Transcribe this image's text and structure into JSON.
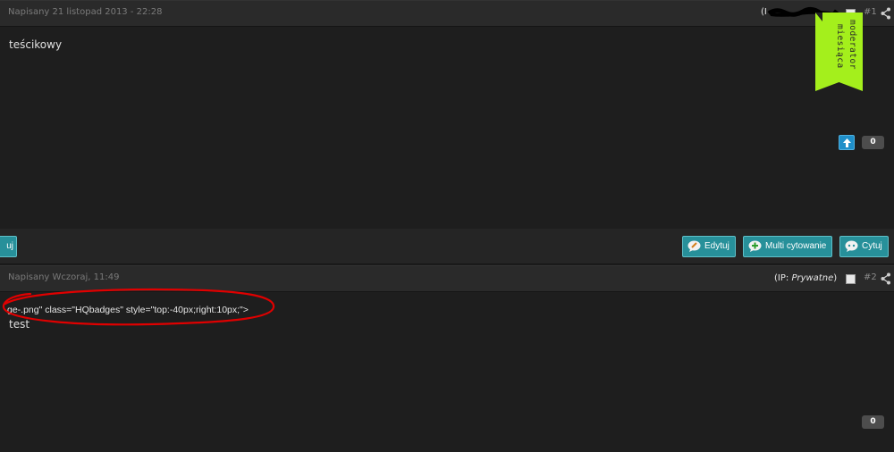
{
  "post1": {
    "date": "Napisany 21 listopad 2013 - 22:28",
    "ip_prefix": "(I",
    "number": "#1",
    "body": "teścikowy",
    "rep_count": "0",
    "badge_text": [
      "moderator",
      "miesiąca"
    ]
  },
  "footer": {
    "left_button": "uj",
    "edit_button": "Edytuj",
    "multiquote_button": "Multi cytowanie",
    "quote_button": "Cytuj"
  },
  "post2": {
    "date": "Napisany Wczoraj, 11:49",
    "ip_label": "(IP: ",
    "ip_value": "Prywatne",
    "ip_close": ")",
    "number": "#2",
    "code": "ge-.png\" class=\"HQbadges\" style=\"top:-40px;right:10px;\">",
    "body": "test",
    "rep_count": "0"
  },
  "colors": {
    "background": "#1e1e1e",
    "header": "#2a2a2a",
    "button": "#27909a",
    "badge": "#a4ef1c",
    "annotation": "#e00000"
  }
}
